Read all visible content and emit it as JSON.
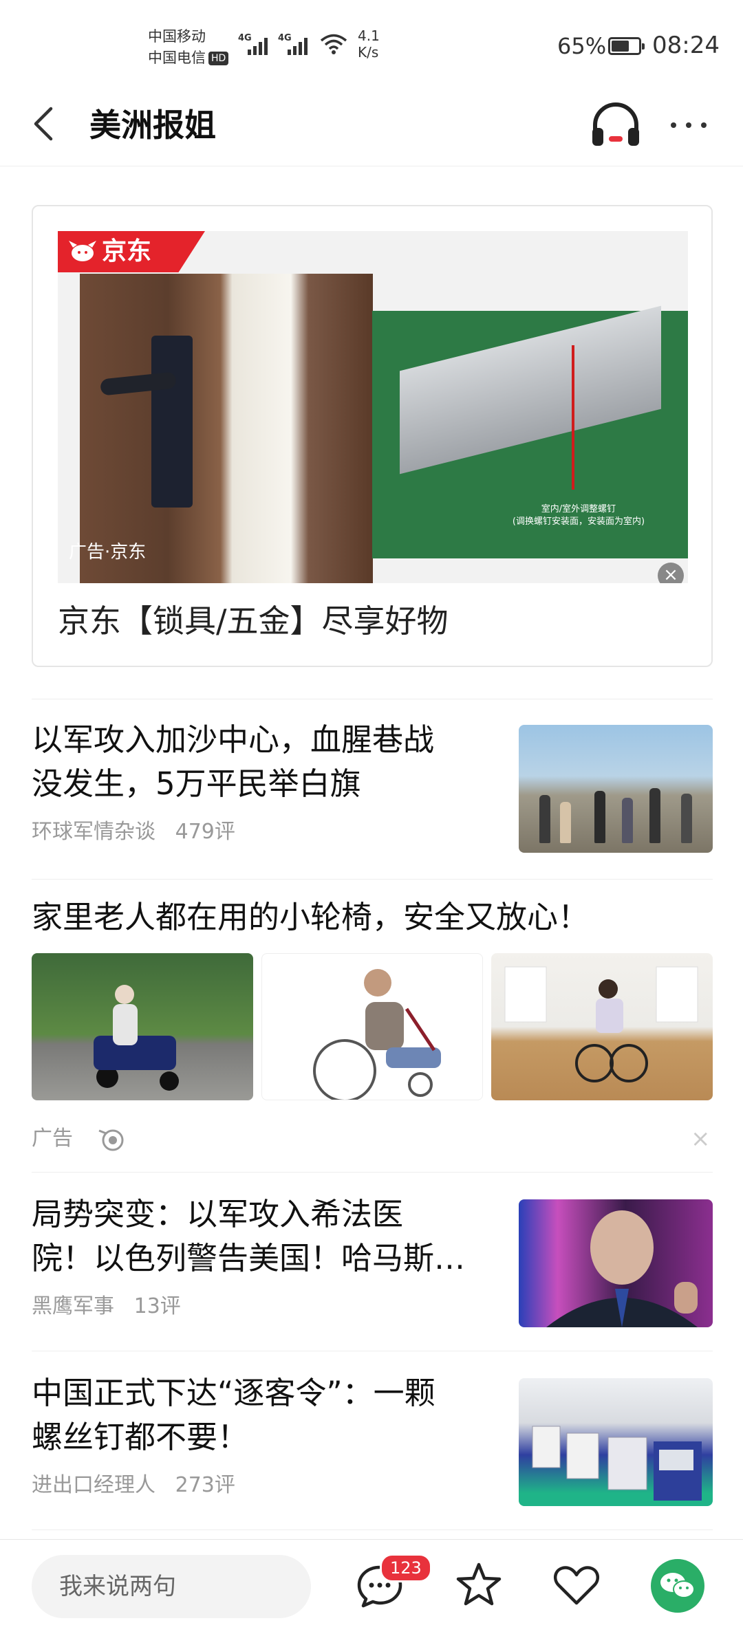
{
  "status_bar": {
    "carrier_1": "中国移动",
    "carrier_2": "中国电信",
    "hd_label": "HD",
    "signal_1_label": "4G",
    "signal_2_label": "4G",
    "net_speed_value": "4.1",
    "net_speed_unit": "K/s",
    "battery_percent": "65%",
    "battery_level": 0.65,
    "time": "08:24"
  },
  "header": {
    "title": "美洲报姐",
    "accent_color": "#e8323c"
  },
  "ad_card": {
    "brand_banner": "京东",
    "source_label": "广告·京东",
    "image_note_line1": "室内/室外调整螺钉",
    "image_note_line2": "(调换螺钉安装面，安装面为室内)",
    "headline": "京东【锁具/五金】尽享好物"
  },
  "feed": [
    {
      "title_line1": "以军攻入加沙中心，血腥巷战",
      "title_line2": "没发生，5万平民举白旗",
      "source": "环球军情杂谈",
      "comments": "479评"
    },
    {
      "title": "家里老人都在用的小轮椅，安全又放心！",
      "ad_label": "广告",
      "dismiss": "×"
    },
    {
      "title_line1": "局势突变：以军攻入希法医",
      "title_line2": "院！以色列警告美国！哈马斯…",
      "source": "黑鹰军事",
      "comments": "13评"
    },
    {
      "title_line1": "中国正式下达“逐客令”：一颗",
      "title_line2": "螺丝钉都不要！",
      "source": "进出口经理人",
      "comments": "273评"
    }
  ],
  "bottom_bar": {
    "comment_placeholder": "我来说两句",
    "comment_count_badge": "123"
  }
}
